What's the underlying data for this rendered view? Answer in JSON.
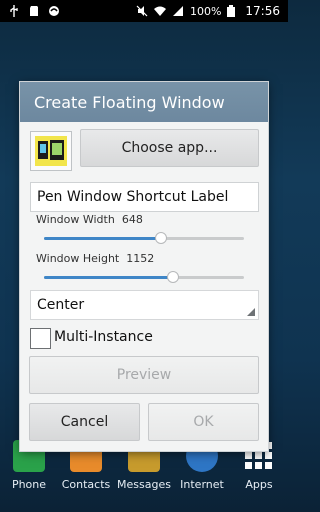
{
  "status_bar": {
    "left_icons": [
      "usb-icon",
      "sd-card-icon",
      "sync-icon"
    ],
    "right_icons": [
      "mute-icon",
      "wifi-icon",
      "signal-icon"
    ],
    "battery": "100%",
    "time": "17:56"
  },
  "dock": {
    "items": [
      {
        "label": "Phone",
        "icon": "phone-icon",
        "color": "#2aa24a"
      },
      {
        "label": "Contacts",
        "icon": "contacts-icon",
        "color": "#e88b2b"
      },
      {
        "label": "Messages",
        "icon": "messages-icon",
        "color": "#c79b2d"
      },
      {
        "label": "Internet",
        "icon": "internet-icon",
        "color": "#2e76c5"
      },
      {
        "label": "Apps",
        "icon": "apps-icon",
        "color": "#ffffff"
      }
    ]
  },
  "dialog": {
    "title": "Create Floating Window",
    "choose_app_label": "Choose app...",
    "shortcut_label_value": "Pen Window Shortcut Label",
    "width_label": "Window Width",
    "width_value": "648",
    "height_label": "Window Height",
    "height_value": "1152",
    "width_slider_fraction": 0.585,
    "height_slider_fraction": 0.645,
    "position_value": "Center",
    "multi_instance_label": "Multi-Instance",
    "multi_instance_checked": false,
    "preview_label": "Preview",
    "cancel_label": "Cancel",
    "ok_label": "OK",
    "accent_color": "#3f86c7"
  }
}
